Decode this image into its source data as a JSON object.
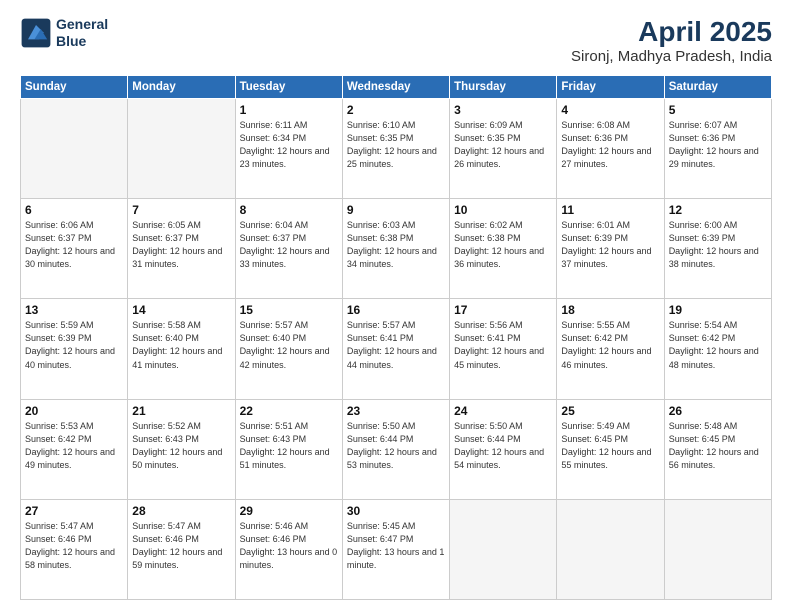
{
  "logo": {
    "line1": "General",
    "line2": "Blue"
  },
  "title": "April 2025",
  "subtitle": "Sironj, Madhya Pradesh, India",
  "days_of_week": [
    "Sunday",
    "Monday",
    "Tuesday",
    "Wednesday",
    "Thursday",
    "Friday",
    "Saturday"
  ],
  "weeks": [
    [
      {
        "day": "",
        "sunrise": "",
        "sunset": "",
        "daylight": "",
        "empty": true
      },
      {
        "day": "",
        "sunrise": "",
        "sunset": "",
        "daylight": "",
        "empty": true
      },
      {
        "day": "1",
        "sunrise": "Sunrise: 6:11 AM",
        "sunset": "Sunset: 6:34 PM",
        "daylight": "Daylight: 12 hours and 23 minutes."
      },
      {
        "day": "2",
        "sunrise": "Sunrise: 6:10 AM",
        "sunset": "Sunset: 6:35 PM",
        "daylight": "Daylight: 12 hours and 25 minutes."
      },
      {
        "day": "3",
        "sunrise": "Sunrise: 6:09 AM",
        "sunset": "Sunset: 6:35 PM",
        "daylight": "Daylight: 12 hours and 26 minutes."
      },
      {
        "day": "4",
        "sunrise": "Sunrise: 6:08 AM",
        "sunset": "Sunset: 6:36 PM",
        "daylight": "Daylight: 12 hours and 27 minutes."
      },
      {
        "day": "5",
        "sunrise": "Sunrise: 6:07 AM",
        "sunset": "Sunset: 6:36 PM",
        "daylight": "Daylight: 12 hours and 29 minutes."
      }
    ],
    [
      {
        "day": "6",
        "sunrise": "Sunrise: 6:06 AM",
        "sunset": "Sunset: 6:37 PM",
        "daylight": "Daylight: 12 hours and 30 minutes."
      },
      {
        "day": "7",
        "sunrise": "Sunrise: 6:05 AM",
        "sunset": "Sunset: 6:37 PM",
        "daylight": "Daylight: 12 hours and 31 minutes."
      },
      {
        "day": "8",
        "sunrise": "Sunrise: 6:04 AM",
        "sunset": "Sunset: 6:37 PM",
        "daylight": "Daylight: 12 hours and 33 minutes."
      },
      {
        "day": "9",
        "sunrise": "Sunrise: 6:03 AM",
        "sunset": "Sunset: 6:38 PM",
        "daylight": "Daylight: 12 hours and 34 minutes."
      },
      {
        "day": "10",
        "sunrise": "Sunrise: 6:02 AM",
        "sunset": "Sunset: 6:38 PM",
        "daylight": "Daylight: 12 hours and 36 minutes."
      },
      {
        "day": "11",
        "sunrise": "Sunrise: 6:01 AM",
        "sunset": "Sunset: 6:39 PM",
        "daylight": "Daylight: 12 hours and 37 minutes."
      },
      {
        "day": "12",
        "sunrise": "Sunrise: 6:00 AM",
        "sunset": "Sunset: 6:39 PM",
        "daylight": "Daylight: 12 hours and 38 minutes."
      }
    ],
    [
      {
        "day": "13",
        "sunrise": "Sunrise: 5:59 AM",
        "sunset": "Sunset: 6:39 PM",
        "daylight": "Daylight: 12 hours and 40 minutes."
      },
      {
        "day": "14",
        "sunrise": "Sunrise: 5:58 AM",
        "sunset": "Sunset: 6:40 PM",
        "daylight": "Daylight: 12 hours and 41 minutes."
      },
      {
        "day": "15",
        "sunrise": "Sunrise: 5:57 AM",
        "sunset": "Sunset: 6:40 PM",
        "daylight": "Daylight: 12 hours and 42 minutes."
      },
      {
        "day": "16",
        "sunrise": "Sunrise: 5:57 AM",
        "sunset": "Sunset: 6:41 PM",
        "daylight": "Daylight: 12 hours and 44 minutes."
      },
      {
        "day": "17",
        "sunrise": "Sunrise: 5:56 AM",
        "sunset": "Sunset: 6:41 PM",
        "daylight": "Daylight: 12 hours and 45 minutes."
      },
      {
        "day": "18",
        "sunrise": "Sunrise: 5:55 AM",
        "sunset": "Sunset: 6:42 PM",
        "daylight": "Daylight: 12 hours and 46 minutes."
      },
      {
        "day": "19",
        "sunrise": "Sunrise: 5:54 AM",
        "sunset": "Sunset: 6:42 PM",
        "daylight": "Daylight: 12 hours and 48 minutes."
      }
    ],
    [
      {
        "day": "20",
        "sunrise": "Sunrise: 5:53 AM",
        "sunset": "Sunset: 6:42 PM",
        "daylight": "Daylight: 12 hours and 49 minutes."
      },
      {
        "day": "21",
        "sunrise": "Sunrise: 5:52 AM",
        "sunset": "Sunset: 6:43 PM",
        "daylight": "Daylight: 12 hours and 50 minutes."
      },
      {
        "day": "22",
        "sunrise": "Sunrise: 5:51 AM",
        "sunset": "Sunset: 6:43 PM",
        "daylight": "Daylight: 12 hours and 51 minutes."
      },
      {
        "day": "23",
        "sunrise": "Sunrise: 5:50 AM",
        "sunset": "Sunset: 6:44 PM",
        "daylight": "Daylight: 12 hours and 53 minutes."
      },
      {
        "day": "24",
        "sunrise": "Sunrise: 5:50 AM",
        "sunset": "Sunset: 6:44 PM",
        "daylight": "Daylight: 12 hours and 54 minutes."
      },
      {
        "day": "25",
        "sunrise": "Sunrise: 5:49 AM",
        "sunset": "Sunset: 6:45 PM",
        "daylight": "Daylight: 12 hours and 55 minutes."
      },
      {
        "day": "26",
        "sunrise": "Sunrise: 5:48 AM",
        "sunset": "Sunset: 6:45 PM",
        "daylight": "Daylight: 12 hours and 56 minutes."
      }
    ],
    [
      {
        "day": "27",
        "sunrise": "Sunrise: 5:47 AM",
        "sunset": "Sunset: 6:46 PM",
        "daylight": "Daylight: 12 hours and 58 minutes."
      },
      {
        "day": "28",
        "sunrise": "Sunrise: 5:47 AM",
        "sunset": "Sunset: 6:46 PM",
        "daylight": "Daylight: 12 hours and 59 minutes."
      },
      {
        "day": "29",
        "sunrise": "Sunrise: 5:46 AM",
        "sunset": "Sunset: 6:46 PM",
        "daylight": "Daylight: 13 hours and 0 minutes."
      },
      {
        "day": "30",
        "sunrise": "Sunrise: 5:45 AM",
        "sunset": "Sunset: 6:47 PM",
        "daylight": "Daylight: 13 hours and 1 minute."
      },
      {
        "day": "",
        "sunrise": "",
        "sunset": "",
        "daylight": "",
        "empty": true
      },
      {
        "day": "",
        "sunrise": "",
        "sunset": "",
        "daylight": "",
        "empty": true
      },
      {
        "day": "",
        "sunrise": "",
        "sunset": "",
        "daylight": "",
        "empty": true
      }
    ]
  ]
}
